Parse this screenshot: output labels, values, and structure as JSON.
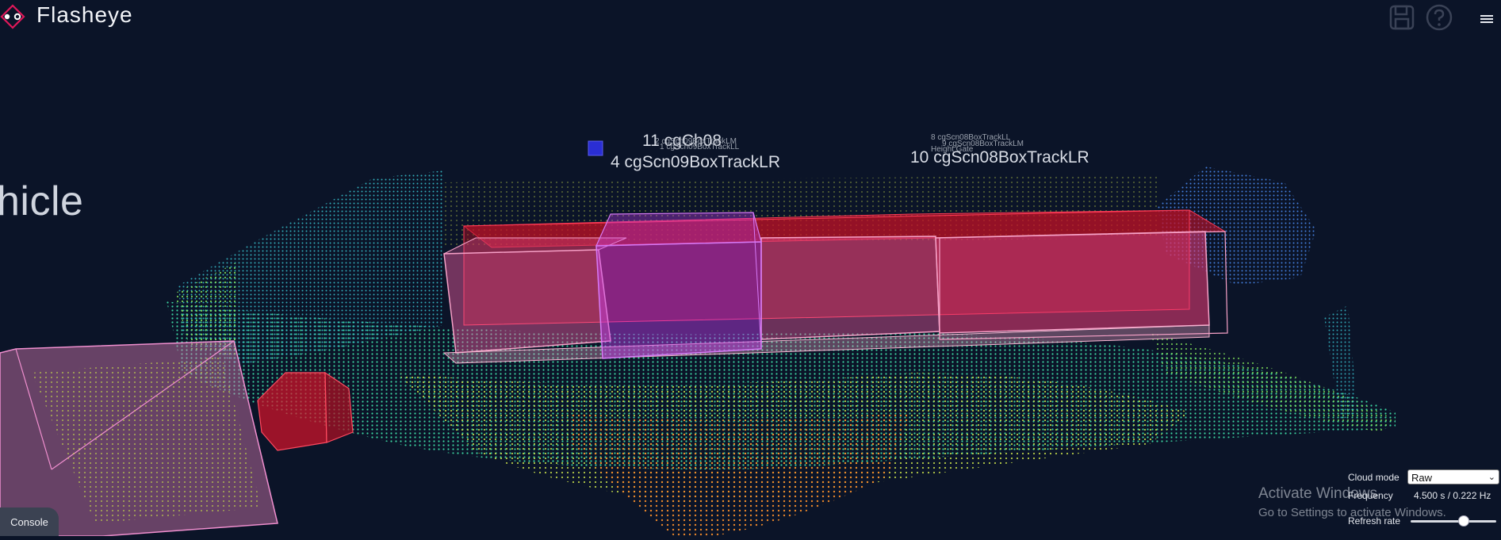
{
  "header": {
    "brand": "Flasheye",
    "save_icon": "save-icon",
    "help_icon": "help-icon",
    "menu_icon": "hamburger-menu-icon"
  },
  "scene": {
    "zone_label": "hicle",
    "object_labels": {
      "ch08": "11 cgCh08",
      "scn09_lr": "4 cgScn09BoxTrackLR",
      "scn08_lr": "10 cgScn08BoxTrackLR",
      "tiny_ll": "8 cgScn08BoxTrackLL",
      "tiny_lm": "9 cgScn08BoxTrackLM",
      "tiny_lm2": "2 cgScn09BoxTrackLM",
      "tiny_ll2": "1 cgScn09BoxTrackLL",
      "tiny_h": "Height Gate"
    },
    "colors": {
      "background": "#0b1428",
      "box_pink": "#f05aa0",
      "box_red": "#d9122a",
      "box_magenta": "#c33cf0"
    }
  },
  "console": {
    "label": "Console"
  },
  "controls": {
    "cloud_mode_label": "Cloud mode",
    "cloud_mode_value": "Raw",
    "frequency_label": "Frequency",
    "frequency_value": "4.500 s / 0.222 Hz",
    "refresh_label": "Refresh rate",
    "refresh_level": 0.62
  },
  "watermark": {
    "line1": "Activate Windows",
    "line2": "Go to Settings to activate Windows."
  }
}
